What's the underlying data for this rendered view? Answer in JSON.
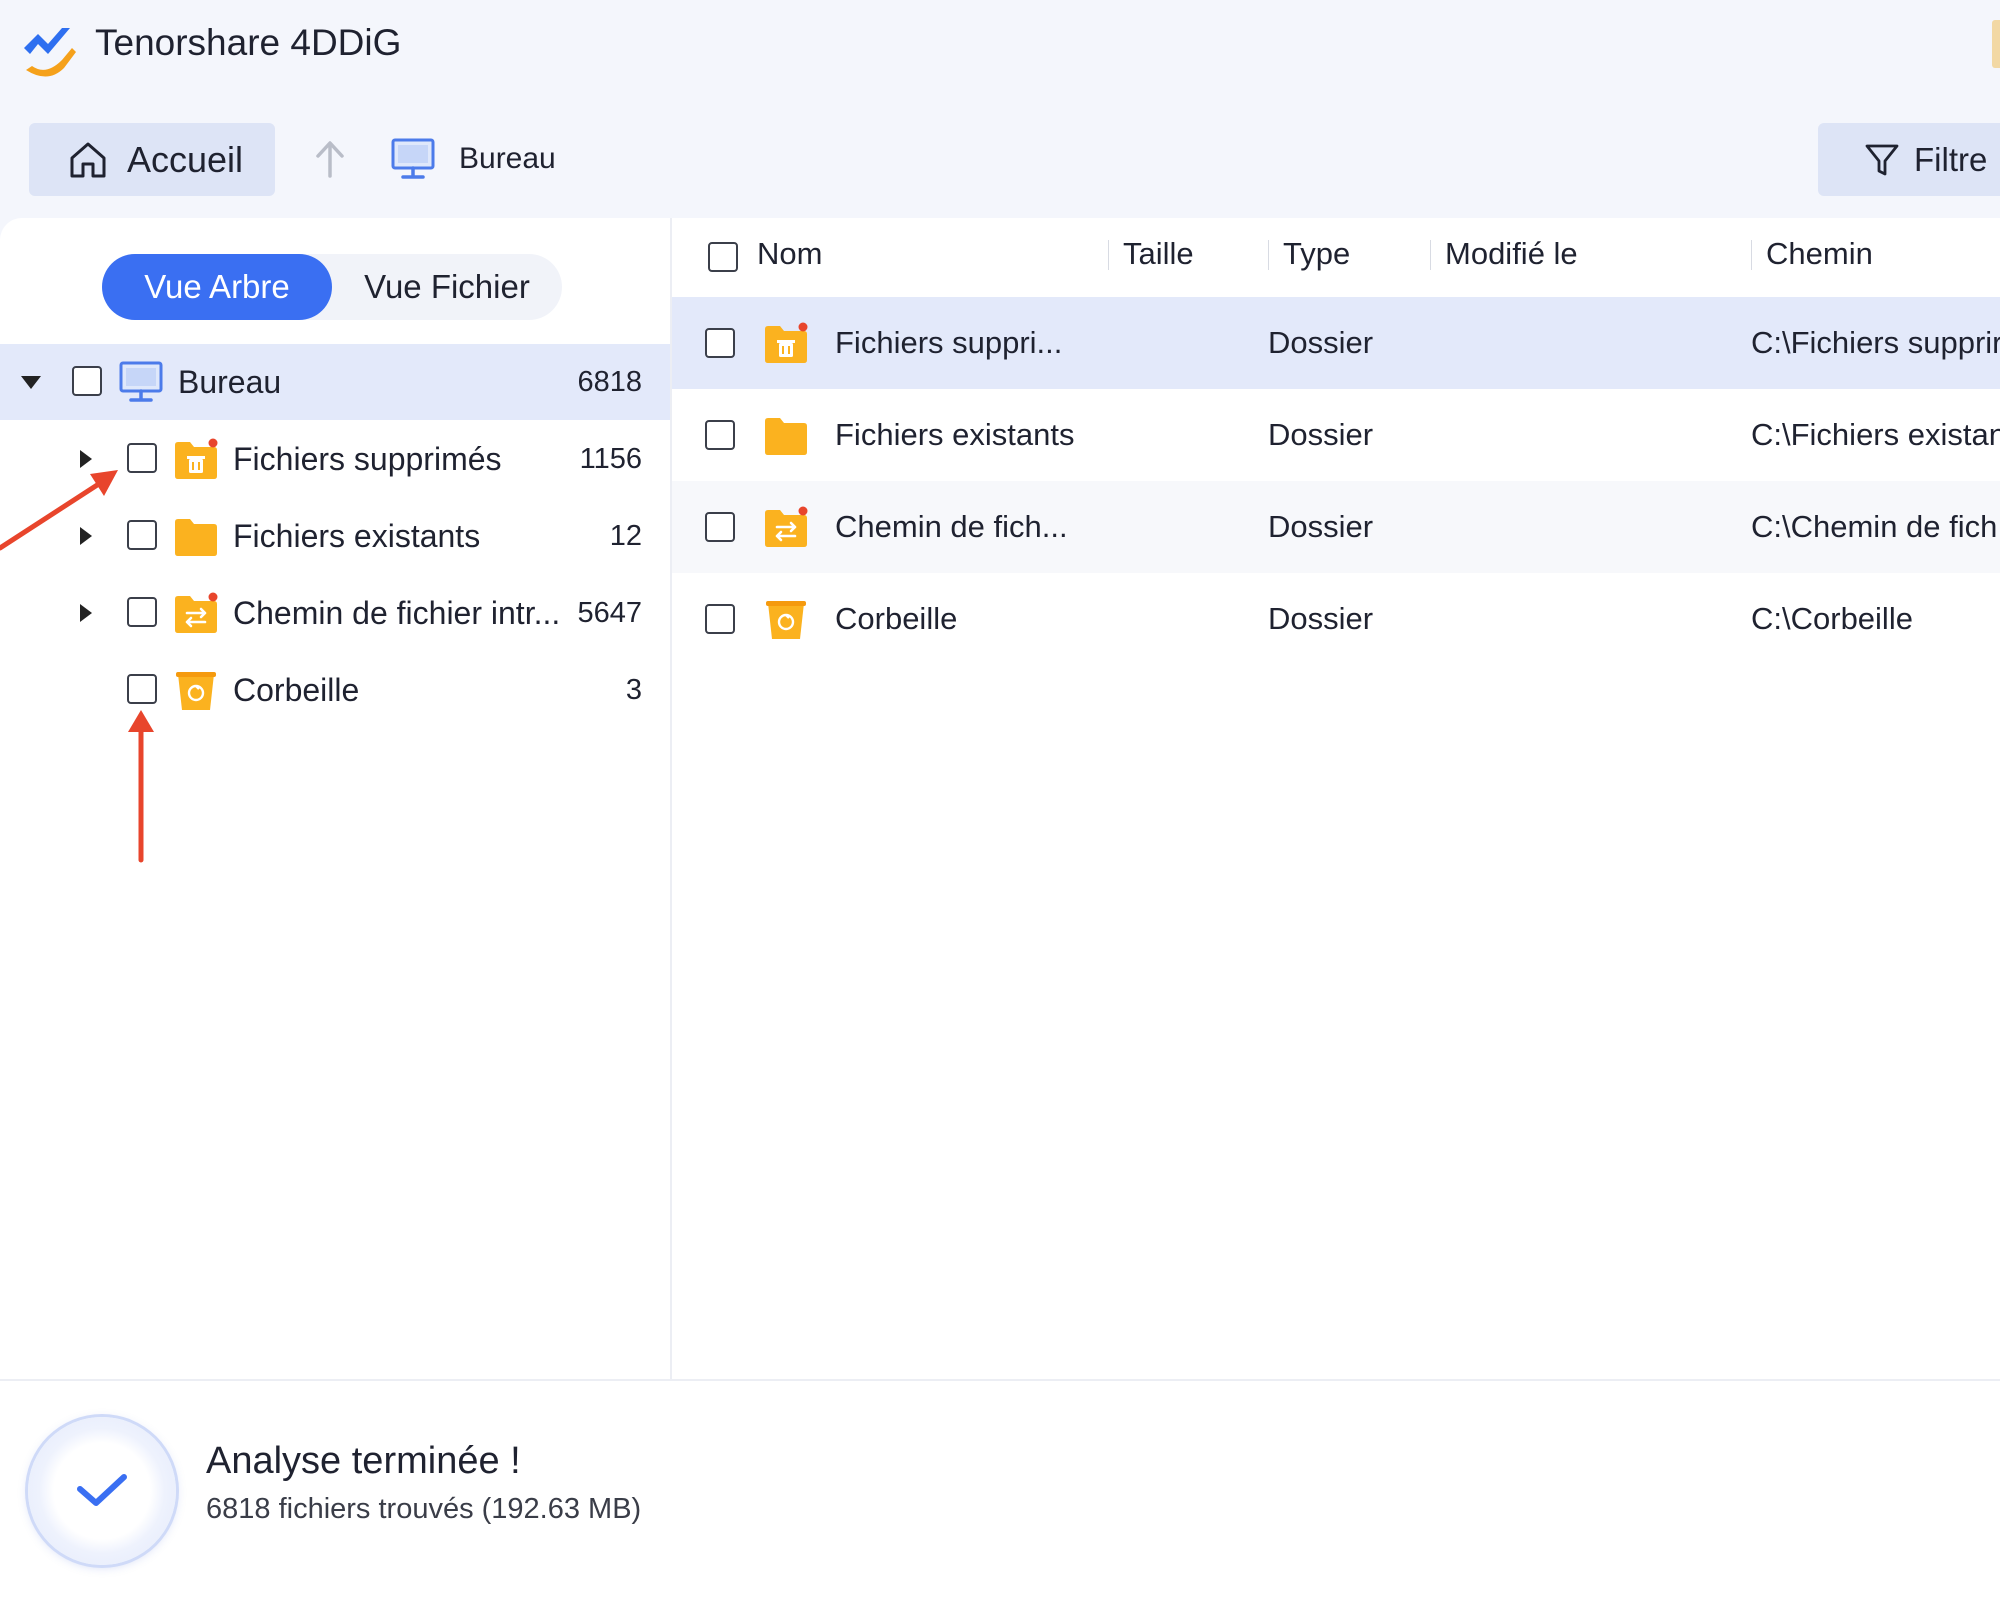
{
  "app": {
    "title": "Tenorshare 4DDiG",
    "logo_icon": "4ddig-logo-icon"
  },
  "toolbar": {
    "home_label": "Accueil",
    "home_icon": "home-icon",
    "up_icon": "arrow-up-icon",
    "breadcrumb_icon": "monitor-icon",
    "breadcrumb_label": "Bureau",
    "filter_label": "Filtre",
    "filter_icon": "filter-icon"
  },
  "view_toggle": {
    "tree_label": "Vue Arbre",
    "file_label": "Vue Fichier",
    "active": "tree"
  },
  "tree": {
    "root": {
      "label": "Bureau",
      "count": "6818",
      "icon": "monitor-icon",
      "expanded": true,
      "checked": false
    },
    "children": [
      {
        "label": "Fichiers supprimés",
        "count": "1156",
        "icon": "deleted-folder-icon",
        "expandable": true,
        "checked": false
      },
      {
        "label": "Fichiers existants",
        "count": "12",
        "icon": "folder-icon",
        "expandable": true,
        "checked": false
      },
      {
        "label": "Chemin de fichier intr...",
        "count": "5647",
        "icon": "lost-path-folder-icon",
        "expandable": true,
        "checked": false
      },
      {
        "label": "Corbeille",
        "count": "3",
        "icon": "recycle-bin-icon",
        "expandable": false,
        "checked": false
      }
    ]
  },
  "table": {
    "columns": [
      "Nom",
      "Taille",
      "Type",
      "Modifié le",
      "Chemin"
    ],
    "rows": [
      {
        "name": "Fichiers suppri...",
        "size": "",
        "type": "Dossier",
        "modified": "",
        "path": "C:\\Fichiers supprir",
        "icon": "deleted-folder-icon"
      },
      {
        "name": "Fichiers existants",
        "size": "",
        "type": "Dossier",
        "modified": "",
        "path": "C:\\Fichiers existan",
        "icon": "folder-icon"
      },
      {
        "name": "Chemin de fich...",
        "size": "",
        "type": "Dossier",
        "modified": "",
        "path": "C:\\Chemin de fich",
        "icon": "lost-path-folder-icon"
      },
      {
        "name": "Corbeille",
        "size": "",
        "type": "Dossier",
        "modified": "",
        "path": "C:\\Corbeille",
        "icon": "recycle-bin-icon"
      }
    ]
  },
  "status": {
    "title": "Analyse terminée !",
    "subtitle": "6818 fichiers trouvés (192.63 MB)",
    "icon": "check-circle-icon"
  },
  "colors": {
    "accent": "#3a6ff2",
    "selected_row": "#e3e9fa",
    "folder": "#fbb21f",
    "annotation": "#e8452c"
  }
}
